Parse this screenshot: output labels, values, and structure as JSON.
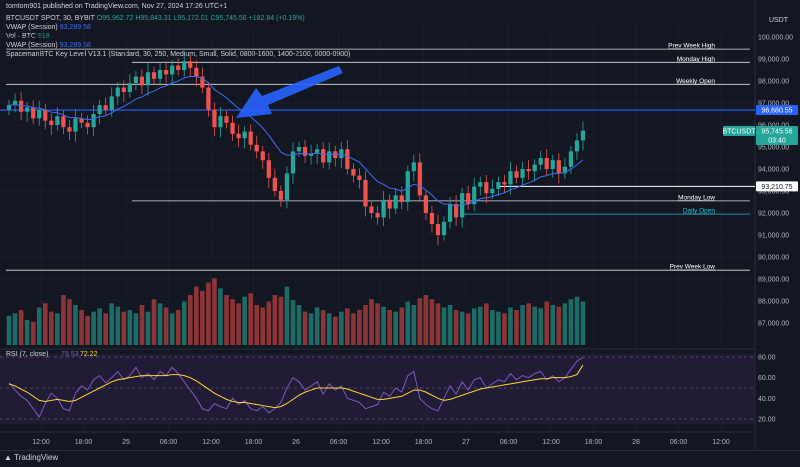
{
  "publisher": "tomtom901 published on TradingView.com, Nov 27, 2024 17:26 UTC+1",
  "currency": "USDT",
  "symbol_line": {
    "name": "BTCUSDT SPOT, 30, BYBIT",
    "open": "O95,962.72",
    "high": "H95,843.31",
    "low": "L95,172.01",
    "close": "C95,745.56",
    "change": "+182.84 (+0.19%)"
  },
  "vwap_line": {
    "label": "VWAP (Session)",
    "value": "93,289.58"
  },
  "vol_line": {
    "label": "Vol · BTC",
    "value": "918"
  },
  "vwap2_line": {
    "label": "VWAP (Session)",
    "value": "93,289.58"
  },
  "indicator_line": "SpacemanBTC Key Level V13.1 (Standard, 30, 250, Medium, Small, Solid, 0800-1600, 1400-2100, 0000-0900)",
  "rsi_line": {
    "label": "RSI (7, close)",
    "value1": "79.53",
    "value2": "72.22"
  },
  "footer_brand": "TradingView",
  "chart_data": {
    "type": "candlestick",
    "price_axis": [
      "100,000.00",
      "99,000.00",
      "98,000.00",
      "97,000.00",
      "96,000.00",
      "95,000.00",
      "94,000.00",
      "93,000.00",
      "92,000.00",
      "91,000.00",
      "90,000.00",
      "89,000.00",
      "88,000.00",
      "87,000.00"
    ],
    "rsi_axis": [
      "80.00",
      "60.00",
      "40.00",
      "20.00"
    ],
    "time_axis": [
      "12:00",
      "18:00",
      "25",
      "06:00",
      "12:00",
      "18:00",
      "26",
      "06:00",
      "12:00",
      "18:00",
      "27",
      "06:00",
      "12:00",
      "18:00",
      "28",
      "06:00",
      "12:00"
    ],
    "ylim": [
      86000,
      100500
    ],
    "key_levels": [
      {
        "label": "Prev Week High",
        "price": 99450,
        "color": "#ffffff"
      },
      {
        "label": "Monday High",
        "price": 98850,
        "color": "#ffffff"
      },
      {
        "label": "Weekly Open",
        "price": 97850,
        "color": "#ffffff"
      },
      {
        "label": "Monday Low",
        "price": 92550,
        "color": "#ffffff"
      },
      {
        "label": "Daily Open",
        "price": 91950,
        "color": "#26c6da"
      },
      {
        "label": "Prev Week Low",
        "price": 89400,
        "color": "#ffffff"
      }
    ],
    "price_tags": [
      {
        "label": "96,680.55",
        "price": 96680,
        "color": "#2962ff"
      },
      {
        "label": "BTCUSDT",
        "price": 95745,
        "color": "#26a69a"
      },
      {
        "label": "95,745.56",
        "price": 95745,
        "color": "#26a69a"
      },
      {
        "label": "03:40",
        "price": 95745,
        "color": "#26a69a"
      },
      {
        "label": "93,210.75",
        "price": 93210,
        "color": "#ffffff"
      }
    ],
    "close": [
      96900,
      97100,
      96600,
      96800,
      96300,
      96700,
      96200,
      96000,
      96400,
      95900,
      95700,
      96300,
      96100,
      95900,
      96500,
      96900,
      96700,
      97300,
      97700,
      97500,
      97900,
      98200,
      97800,
      98400,
      98100,
      98500,
      98300,
      98700,
      98500,
      98900,
      98600,
      98200,
      97700,
      96700,
      95900,
      96400,
      96100,
      95600,
      95400,
      95700,
      95100,
      94800,
      94400,
      93600,
      93000,
      92600,
      93800,
      94800,
      95000,
      94600,
      94700,
      94900,
      94300,
      94800,
      94500,
      94900,
      94000,
      93700,
      93500,
      92300,
      92000,
      91800,
      92600,
      92200,
      92800,
      92500,
      93900,
      94300,
      92800,
      92000,
      91500,
      91000,
      91600,
      92400,
      91800,
      92900,
      92400,
      93200,
      93400,
      92900,
      93100,
      93400,
      93300,
      93900,
      93600,
      94000,
      93900,
      94200,
      94500,
      94000,
      94400,
      93800,
      94100,
      94800,
      95300,
      95745
    ],
    "volume": [
      35,
      38,
      42,
      30,
      28,
      45,
      50,
      40,
      38,
      60,
      55,
      48,
      42,
      35,
      40,
      44,
      38,
      50,
      46,
      40,
      42,
      38,
      48,
      40,
      55,
      50,
      45,
      38,
      42,
      52,
      60,
      70,
      65,
      75,
      80,
      68,
      60,
      55,
      50,
      58,
      62,
      48,
      45,
      52,
      60,
      58,
      70,
      54,
      48,
      40,
      38,
      45,
      42,
      38,
      34,
      40,
      44,
      38,
      42,
      48,
      55,
      50,
      46,
      42,
      40,
      45,
      52,
      48,
      56,
      60,
      55,
      50,
      45,
      48,
      42,
      40,
      38,
      44,
      46,
      50,
      42,
      40,
      38,
      45,
      42,
      48,
      50,
      46,
      44,
      52,
      48,
      46,
      50,
      55,
      58,
      52
    ],
    "rsi": [
      55,
      48,
      42,
      38,
      30,
      22,
      35,
      45,
      40,
      30,
      28,
      45,
      52,
      48,
      58,
      62,
      55,
      60,
      66,
      58,
      62,
      70,
      60,
      64,
      58,
      66,
      62,
      70,
      64,
      56,
      48,
      40,
      30,
      28,
      35,
      32,
      30,
      40,
      34,
      38,
      30,
      28,
      32,
      26,
      30,
      36,
      50,
      60,
      56,
      48,
      52,
      56,
      44,
      54,
      48,
      52,
      40,
      38,
      36,
      30,
      32,
      34,
      46,
      42,
      50,
      46,
      62,
      66,
      40,
      34,
      30,
      28,
      40,
      52,
      44,
      56,
      48,
      58,
      60,
      50,
      54,
      58,
      56,
      64,
      58,
      62,
      60,
      64,
      66,
      58,
      62,
      56,
      60,
      68,
      76,
      79.5
    ],
    "rsi_ma": [
      54,
      52,
      49,
      46,
      42,
      38,
      37,
      38,
      39,
      38,
      37,
      38,
      41,
      44,
      47,
      50,
      53,
      56,
      58,
      59,
      60,
      61,
      62,
      62,
      62,
      62,
      62,
      63,
      63,
      62,
      60,
      57,
      53,
      49,
      45,
      42,
      39,
      37,
      36,
      36,
      35,
      34,
      33,
      32,
      31,
      32,
      35,
      39,
      43,
      46,
      48,
      50,
      50,
      50,
      50,
      50,
      49,
      47,
      45,
      43,
      41,
      39,
      39,
      40,
      41,
      42,
      45,
      48,
      48,
      46,
      43,
      40,
      38,
      39,
      41,
      43,
      45,
      47,
      49,
      50,
      51,
      52,
      53,
      54,
      55,
      56,
      57,
      58,
      59,
      59,
      60,
      60,
      60,
      61,
      63,
      72.2
    ]
  }
}
